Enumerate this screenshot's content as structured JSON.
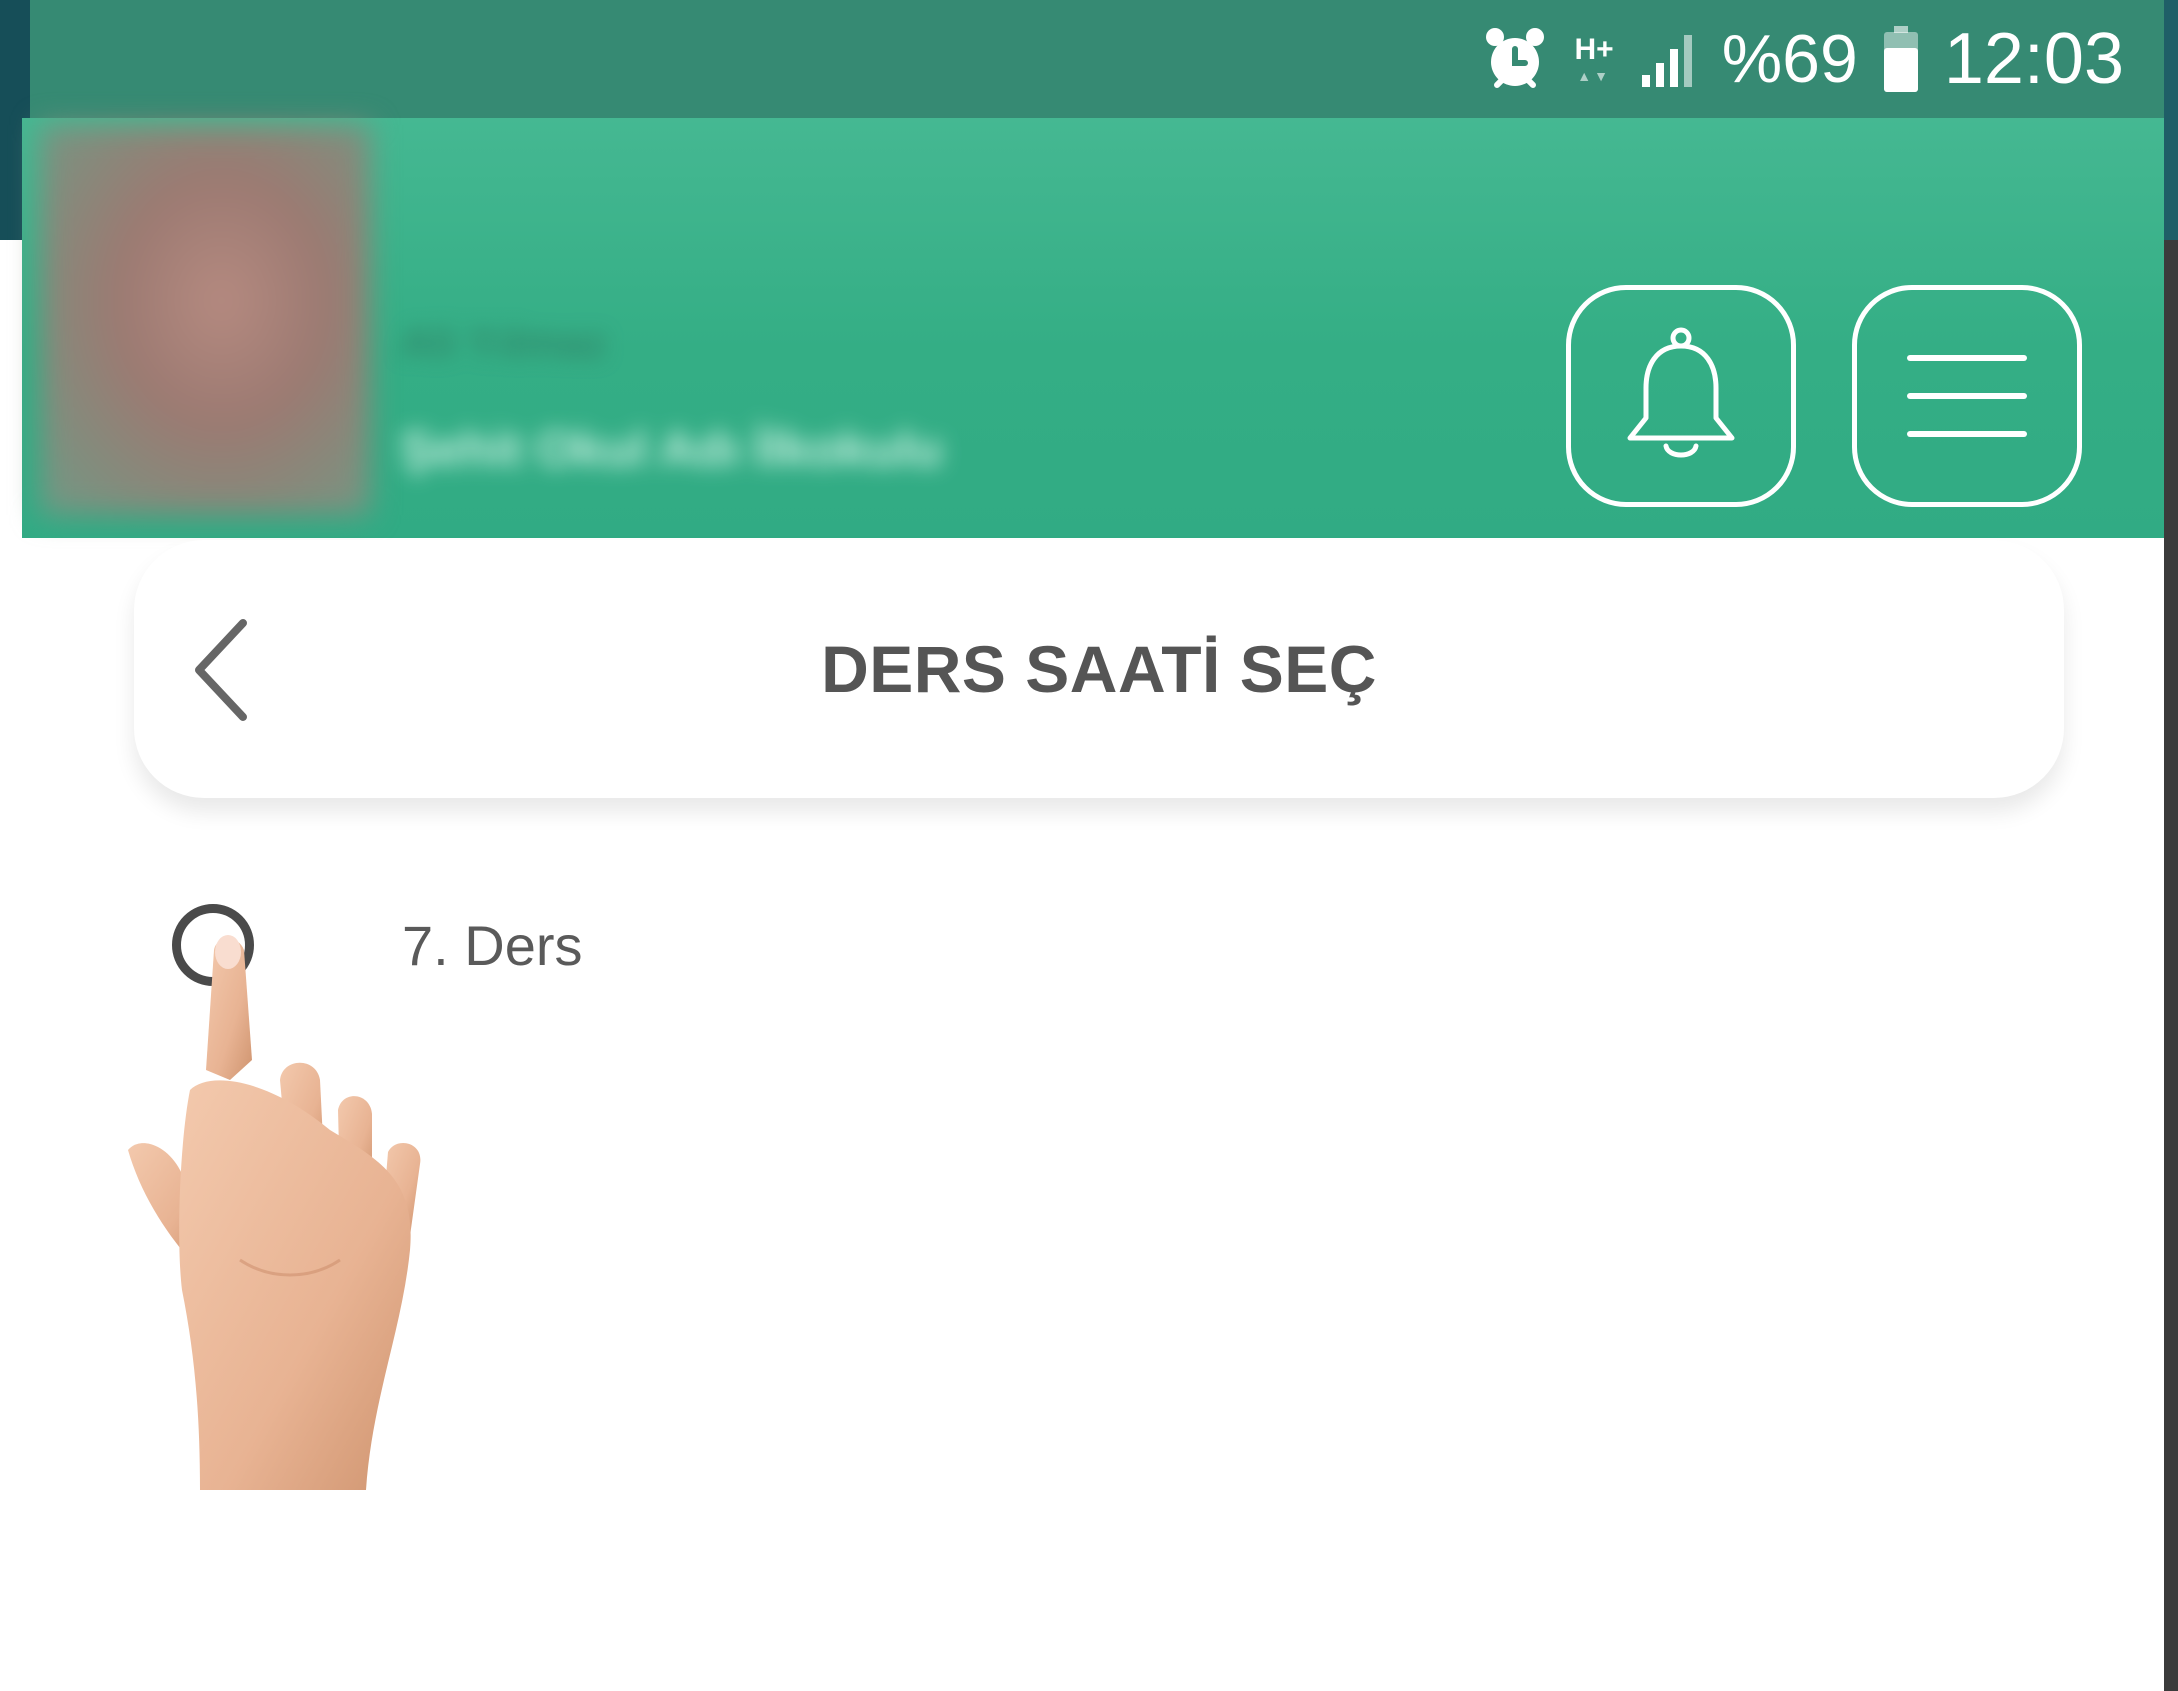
{
  "status_bar": {
    "network_label": "H+",
    "battery_percent": "%69",
    "time": "12:03",
    "icons": [
      "alarm-icon",
      "network-type-icon",
      "signal-icon",
      "battery-icon"
    ]
  },
  "header": {
    "user_name": "Ali Yılmaz",
    "school_name": "Şehit Okul Adı İlkokulu",
    "icons": [
      "bell-icon",
      "menu-icon"
    ]
  },
  "panel": {
    "title": "DERS SAATİ SEÇ",
    "back_icon": "chevron-left-icon"
  },
  "options": [
    {
      "label": "7. Ders",
      "selected": false
    }
  ],
  "colors": {
    "status_bar": "#368a73",
    "header_green": "#3ab389",
    "title_text": "#555555",
    "option_text": "#5a5a5a"
  }
}
